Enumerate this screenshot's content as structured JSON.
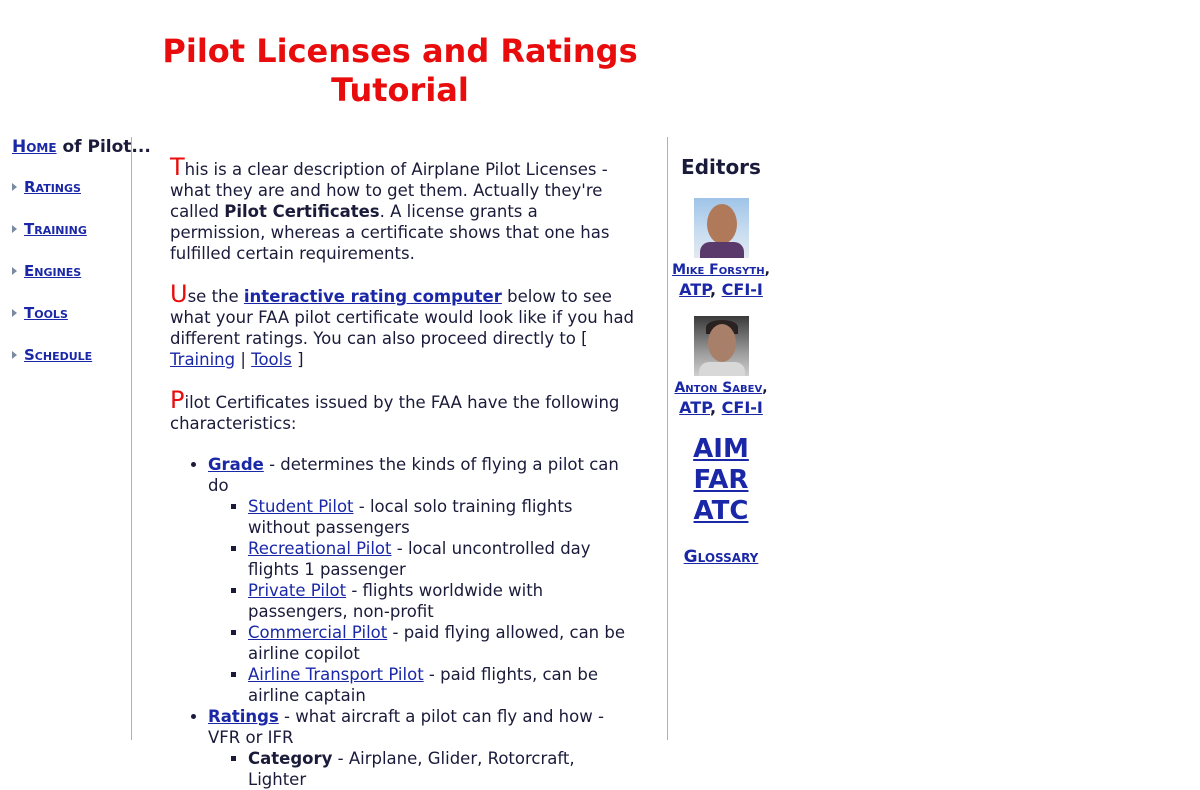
{
  "title": {
    "line1": "Pilot Licenses and Ratings",
    "line2": "Tutorial"
  },
  "nav": {
    "home_link": "Home",
    "home_suffix": " of Pilot...",
    "items": [
      {
        "label": "Ratings"
      },
      {
        "label": "Training"
      },
      {
        "label": "Engines"
      },
      {
        "label": "Tools"
      },
      {
        "label": "Schedule"
      }
    ]
  },
  "main": {
    "p1": {
      "drop": "T",
      "text1": "his is a clear description of Airplane Pilot Licenses - what they are and how to get them. Actually they're called ",
      "bold": "Pilot Certificates",
      "text2": ". A license grants a permission, whereas a certificate shows that one has fulfilled certain requirements."
    },
    "p2": {
      "drop": "U",
      "text1": "se the ",
      "link": "interactive rating computer",
      "text2": " below to see what your FAA pilot certificate would look like if you had different ratings. You can also proceed directly to [ ",
      "link_training": "Training",
      "sep": " | ",
      "link_tools": "Tools",
      "text3": " ]"
    },
    "p3": {
      "drop": "P",
      "text1": "ilot Certificates issued by the FAA have the following characteristics:"
    },
    "grade": {
      "link": "Grade",
      "desc": " - determines the kinds of flying a pilot can do",
      "items": [
        {
          "link": "Student Pilot",
          "desc": " - local solo training flights without passengers"
        },
        {
          "link": "Recreational Pilot",
          "desc": " - local uncontrolled day flights 1 passenger"
        },
        {
          "link": "Private Pilot",
          "desc": " - flights worldwide with passengers, non-profit"
        },
        {
          "link": "Commercial Pilot",
          "desc": " - paid flying allowed, can be airline copilot"
        },
        {
          "link": "Airline Transport Pilot",
          "desc": " - paid flights, can be airline captain"
        }
      ]
    },
    "ratings": {
      "link": "Ratings",
      "desc": " - what aircraft a pilot can fly and how - VFR or IFR",
      "items": [
        {
          "bold": "Category",
          "desc": " - Airplane, Glider, Rotorcraft, Lighter"
        }
      ]
    }
  },
  "editors": {
    "heading": "Editors",
    "people": [
      {
        "name": "Mike Forsyth",
        "comma": ",",
        "cred1": "ATP",
        "sep": ", ",
        "cred2": "CFI-I"
      },
      {
        "name": "Anton Sabev",
        "comma": ",",
        "cred1": "ATP",
        "sep": ", ",
        "cred2": "CFI-I"
      }
    ],
    "refs": [
      "AIM",
      "FAR",
      "ATC"
    ],
    "glossary": "Glossary"
  }
}
